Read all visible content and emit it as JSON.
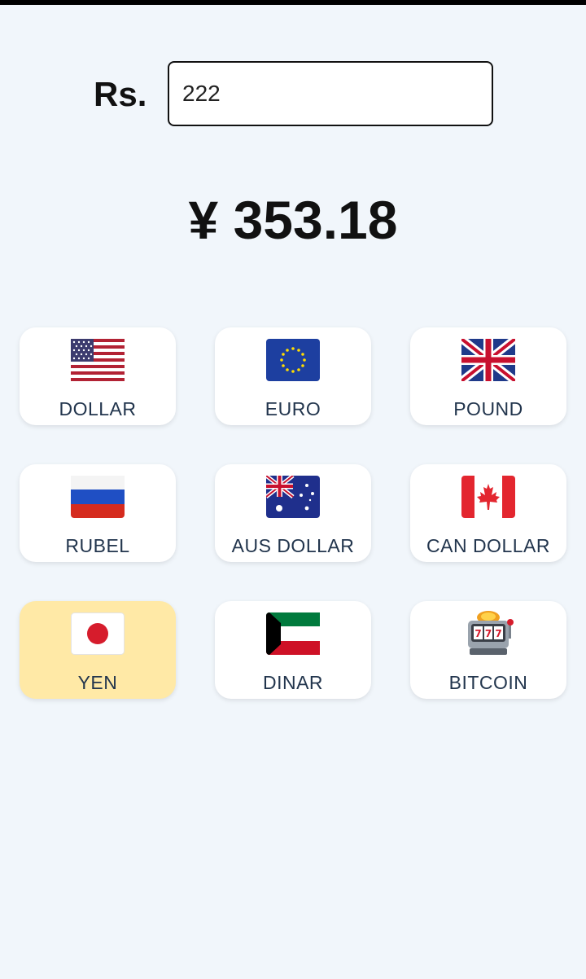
{
  "input": {
    "currency_label": "Rs.",
    "value": "222"
  },
  "result": {
    "text": "¥ 353.18"
  },
  "currencies": [
    {
      "label": "DOLLAR",
      "icon": "us-flag-icon",
      "selected": false
    },
    {
      "label": "EURO",
      "icon": "eu-flag-icon",
      "selected": false
    },
    {
      "label": "POUND",
      "icon": "uk-flag-icon",
      "selected": false
    },
    {
      "label": "RUBEL",
      "icon": "russia-flag-icon",
      "selected": false
    },
    {
      "label": "AUS DOLLAR",
      "icon": "australia-flag-icon",
      "selected": false
    },
    {
      "label": "CAN DOLLAR",
      "icon": "canada-flag-icon",
      "selected": false
    },
    {
      "label": "YEN",
      "icon": "japan-flag-icon",
      "selected": true
    },
    {
      "label": "DINAR",
      "icon": "kuwait-flag-icon",
      "selected": false
    },
    {
      "label": "BITCOIN",
      "icon": "slot-machine-icon",
      "selected": false
    }
  ],
  "colors": {
    "background": "#f1f6fb",
    "card": "#ffffff",
    "selected_card": "#ffe9a6",
    "label_text": "#22354d"
  }
}
